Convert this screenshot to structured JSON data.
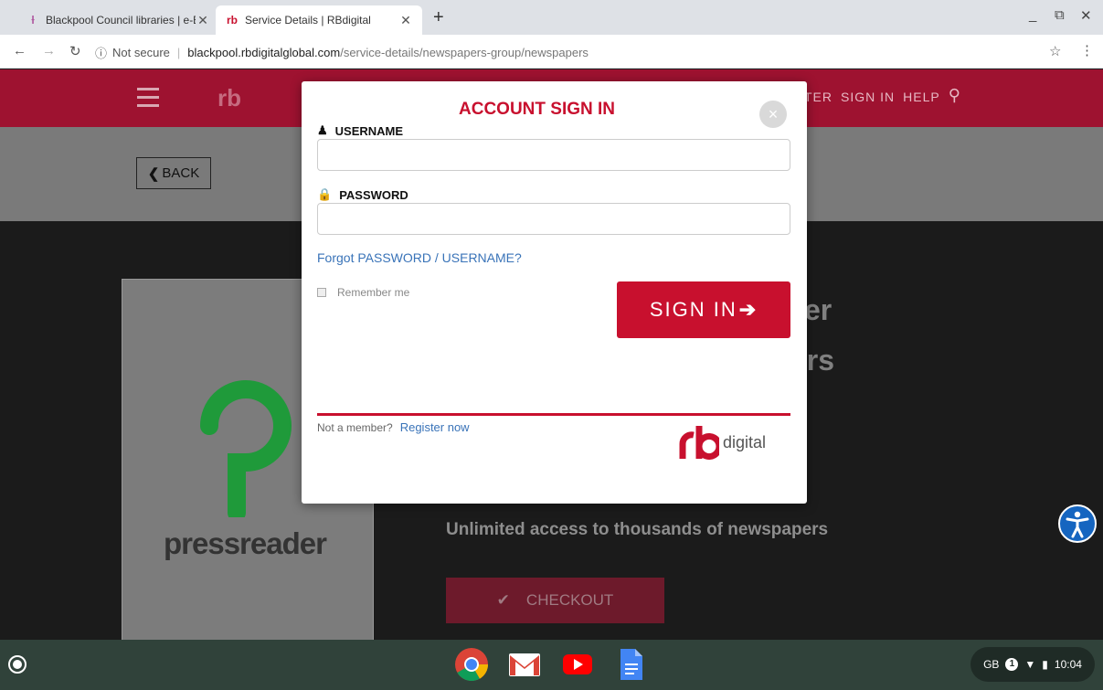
{
  "browser": {
    "tabs": [
      {
        "title": "Blackpool Council libraries | e-Bo",
        "active": false
      },
      {
        "title": "Service Details | RBdigital",
        "active": true
      }
    ],
    "new_tab": "+",
    "controls": {
      "minimize": "_",
      "restore": "⧉",
      "close": "✕"
    },
    "address": {
      "security": "Not secure",
      "host": "blackpool.rbdigitalglobal.com",
      "path": "/service-details/newspapers-group/newspapers"
    }
  },
  "site": {
    "nav": [
      "TER",
      "SIGN IN",
      "HELP"
    ],
    "back_label": "BACK",
    "cover_brand": "pressreader",
    "bg_title_line1": "er",
    "bg_title_line2": "ers",
    "tagline": "Unlimited access to thousands of newspapers",
    "checkout_label": "CHECKOUT"
  },
  "modal": {
    "title": "ACCOUNT SIGN IN",
    "close": "×",
    "username_label": "USERNAME",
    "username_value": "",
    "password_label": "PASSWORD",
    "password_value": "",
    "forgot_link": "Forgot PASSWORD / USERNAME?",
    "remember_label": "Remember me",
    "signin_button": "SIGN IN",
    "not_member": "Not a member?",
    "register_link": "Register now",
    "logo_word": "digital"
  },
  "shelf": {
    "apps": [
      "chrome-icon",
      "gmail-icon",
      "youtube-icon",
      "docs-icon"
    ],
    "tray": {
      "locale": "GB",
      "notifications": "1",
      "time": "10:04"
    }
  },
  "colors": {
    "brand_red": "#c8102e",
    "link_blue": "#3973b8",
    "shelf": "#30423a"
  }
}
